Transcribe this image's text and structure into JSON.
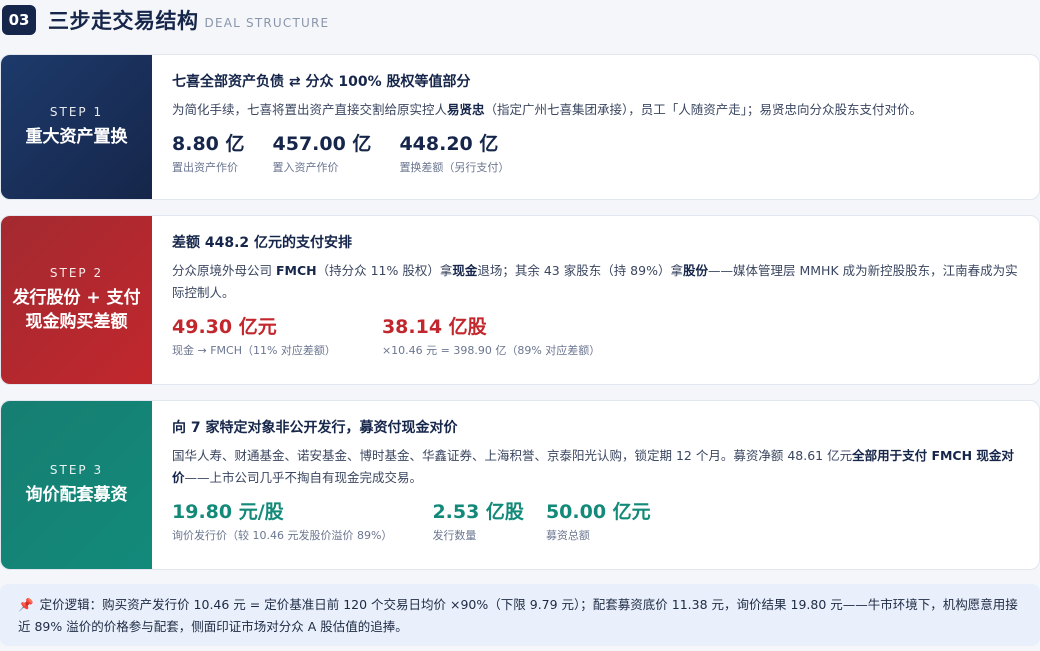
{
  "header": {
    "num": "03",
    "title": "三步走交易结构",
    "subtitle": "DEAL STRUCTURE"
  },
  "steps": [
    {
      "label": "STEP 1",
      "name": "重大资产置换",
      "title": "七喜全部资产负债 ⇄ 分众 100% 股权等值部分",
      "desc": [
        {
          "t": "为简化手续，七喜将置出资产直接交割给原实控人"
        },
        {
          "t": "易贤忠",
          "b": true
        },
        {
          "t": "（指定广州七喜集团承接），员工「人随资产走」；易贤忠向分众股东支付对价。"
        }
      ],
      "metrics": [
        {
          "value": "8.80 亿",
          "label": "置出资产作价"
        },
        {
          "value": "457.00 亿",
          "label": "置入资产作价"
        },
        {
          "value": "448.20 亿",
          "label": "置换差额（另行支付）"
        }
      ]
    },
    {
      "label": "STEP 2",
      "name": "发行股份 + 支付现金购买差额",
      "title": "差额 448.2 亿元的支付安排",
      "desc": [
        {
          "t": "分众原境外母公司 "
        },
        {
          "t": "FMCH",
          "b": true
        },
        {
          "t": "（持分众 11% 股权）拿"
        },
        {
          "t": "现金",
          "b": true
        },
        {
          "t": "退场；其余 43 家股东（持 89%）拿"
        },
        {
          "t": "股份",
          "b": true
        },
        {
          "t": "——媒体管理层 MMHK 成为新控股股东，江南春成为实际控制人。"
        }
      ],
      "metrics": [
        {
          "value": "49.30 亿元",
          "label": "现金 → FMCH（11% 对应差额）"
        },
        {
          "value": "38.14 亿股",
          "label": "×10.46 元 = 398.90 亿（89% 对应差额）"
        }
      ]
    },
    {
      "label": "STEP 3",
      "name": "询价配套募资",
      "title": "向 7 家特定对象非公开发行，募资付现金对价",
      "desc": [
        {
          "t": "国华人寿、财通基金、诺安基金、博时基金、华鑫证券、上海积誉、京泰阳光认购，锁定期 12 个月。募资净额 48.61 亿元"
        },
        {
          "t": "全部用于支付 FMCH 现金对价",
          "b": true
        },
        {
          "t": "——上市公司几乎不掏自有现金完成交易。"
        }
      ],
      "metrics": [
        {
          "value": "19.80 元/股",
          "label": "询价发行价（较 10.46 元发股价溢价 89%）"
        },
        {
          "value": "2.53 亿股",
          "label": "发行数量"
        },
        {
          "value": "50.00 亿元",
          "label": "募资总额"
        }
      ]
    }
  ],
  "note": {
    "icon": "📌",
    "text": "定价逻辑：购买资产发行价 10.46 元 = 定价基准日前 120 个交易日均价 ×90%（下限 9.79 元）；配套募资底价 11.38 元，询价结果 19.80 元——牛市环境下，机构愿意用接近 89% 溢价的价格参与配套，侧面印证市场对分众 A 股估值的追捧。"
  }
}
